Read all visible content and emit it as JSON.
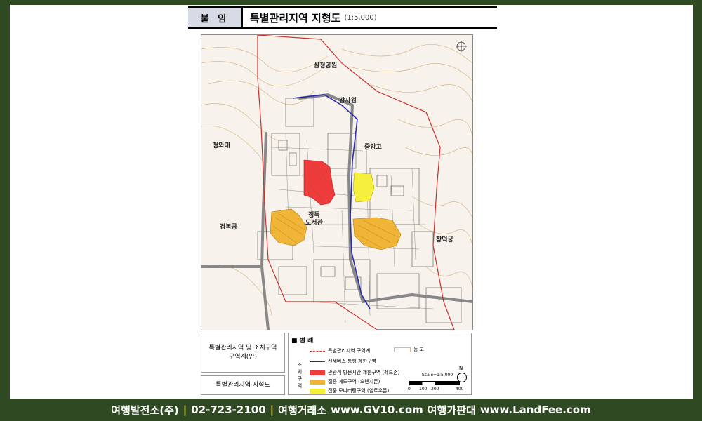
{
  "header": {
    "tag": "붙 임",
    "title": "특별관리지역 지형도",
    "scale": "(1:5,000)"
  },
  "map": {
    "places": {
      "samcheong_park": "삼청공원",
      "gamsawon": "감사원",
      "cheongwadae": "청와대",
      "jungang_high": "중앙고",
      "gyeongbokgung": "경복궁",
      "jeongdok_library": "정독\n도서관",
      "changdeokgung": "창덕궁"
    },
    "colors": {
      "red_zone": "#ee3b3b",
      "orange_zone": "#f0b437",
      "yellow_zone": "#f5ef3d",
      "boundary": "#c9302c",
      "bus_route": "#2b2bb0"
    }
  },
  "legend_left": {
    "box1": "특별관리지역 및 조치구역\n구역계(안)",
    "box2": "특별관리지역 지형도"
  },
  "legend": {
    "title": "■ 범 례",
    "boundary": "특별관리지역 구역계",
    "contour": "등 고",
    "bus": "전세버스 통행 제한구역",
    "group_label": "조\n치\n구\n역",
    "red": "관광객 방문시간 제한구역 (레드존)",
    "orange": "집중 계도구역 (오렌지존)",
    "yellow": "집중 모니터링구역 (옐로우존)",
    "scale_label": "Scale=1:5,000",
    "scale_ticks": [
      "0",
      "100",
      "200",
      "400"
    ],
    "north": "N"
  },
  "footer": {
    "part1": "여행발전소(주)",
    "phone": "02-723-2100",
    "part2": "여행거래소",
    "site1": "www.GV10.com",
    "part3": "여행가판대",
    "site2": "www.LandFee.com",
    "sep": "|"
  }
}
